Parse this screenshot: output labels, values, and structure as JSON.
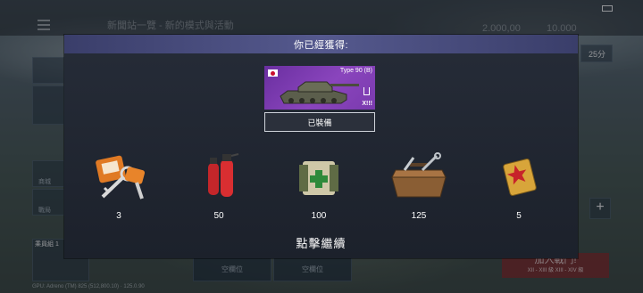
{
  "background": {
    "top_title": "新聞站一覽 - 新的模式與活動",
    "currency_silver": "2.000,00",
    "currency_gold": "10.000",
    "timer_badge": "25分",
    "sidebar_labels": [
      "商城",
      "戰局"
    ],
    "crew_label": "乘員組 1",
    "slots": [
      "空欄位",
      "空欄位"
    ],
    "join_button": "加入戰鬥!",
    "join_tiers": "XII - XIII 級 XIII - XIV 級",
    "gpu_info": "GPU: Adreno (TM) 825 (512,800.10) · 125.0.90"
  },
  "modal": {
    "title": "你已經獲得:",
    "tank": {
      "name": "Type 90 (B)",
      "tier": "X!!!",
      "flag": "japan"
    },
    "equip_label": "已裝備",
    "rewards": [
      {
        "icon": "keys-icon",
        "amount": "3"
      },
      {
        "icon": "fire-extinguisher-icon",
        "amount": "50"
      },
      {
        "icon": "medkit-icon",
        "amount": "100"
      },
      {
        "icon": "toolbox-icon",
        "amount": "125"
      },
      {
        "icon": "star-card-icon",
        "amount": "5"
      }
    ],
    "continue_label": "點擊繼續"
  },
  "colors": {
    "header": "#55598e",
    "tank_card": "#8a45bd",
    "modal_bg": "#1c212b"
  }
}
